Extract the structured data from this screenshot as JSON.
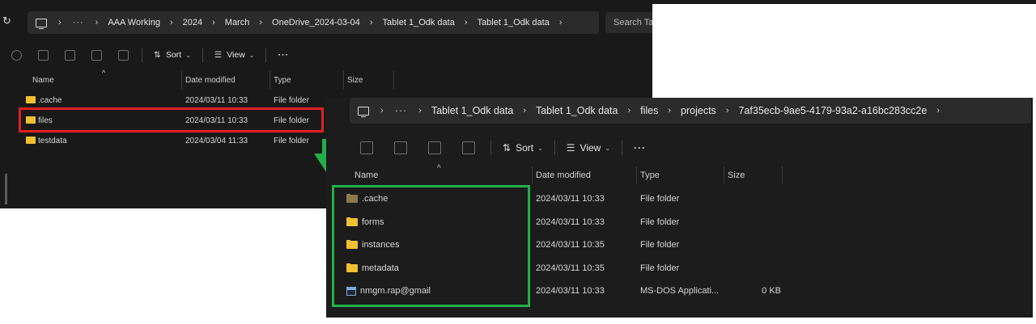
{
  "window1": {
    "breadcrumb": [
      "AAA Working",
      "2024",
      "March",
      "OneDrive_2024-03-04",
      "Tablet 1_Odk data",
      "Tablet 1_Odk data"
    ],
    "search_placeholder": "Search Tab",
    "toolbar": {
      "sort_label": "Sort",
      "view_label": "View"
    },
    "columns": [
      "Name",
      "Date modified",
      "Type",
      "Size"
    ],
    "rows": [
      {
        "name": ".cache",
        "date": "2024/03/11 10:33",
        "type": "File folder"
      },
      {
        "name": "files",
        "date": "2024/03/11 10:33",
        "type": "File folder"
      },
      {
        "name": "testdata",
        "date": "2024/03/04 11:33",
        "type": "File folder"
      }
    ]
  },
  "window2": {
    "breadcrumb": [
      "Tablet 1_Odk data",
      "Tablet 1_Odk data",
      "files",
      "projects",
      "7af35ecb-9ae5-4179-93a2-a16bc283cc2e"
    ],
    "toolbar": {
      "sort_label": "Sort",
      "view_label": "View"
    },
    "columns": [
      "Name",
      "Date modified",
      "Type",
      "Size"
    ],
    "rows": [
      {
        "name": ".cache",
        "date": "2024/03/11 10:33",
        "type": "File folder",
        "size": ""
      },
      {
        "name": "forms",
        "date": "2024/03/11 10:33",
        "type": "File folder",
        "size": ""
      },
      {
        "name": "instances",
        "date": "2024/03/11 10:35",
        "type": "File folder",
        "size": ""
      },
      {
        "name": "metadata",
        "date": "2024/03/11 10:35",
        "type": "File folder",
        "size": ""
      },
      {
        "name": "nmgm.rap@gmail",
        "date": "2024/03/11 10:33",
        "type": "MS-DOS Applicati...",
        "size": "0 KB"
      }
    ]
  },
  "annotations": {
    "highlight_color": "#e02020",
    "result_color": "#22b04a",
    "arrow_color": "#22b04a"
  }
}
